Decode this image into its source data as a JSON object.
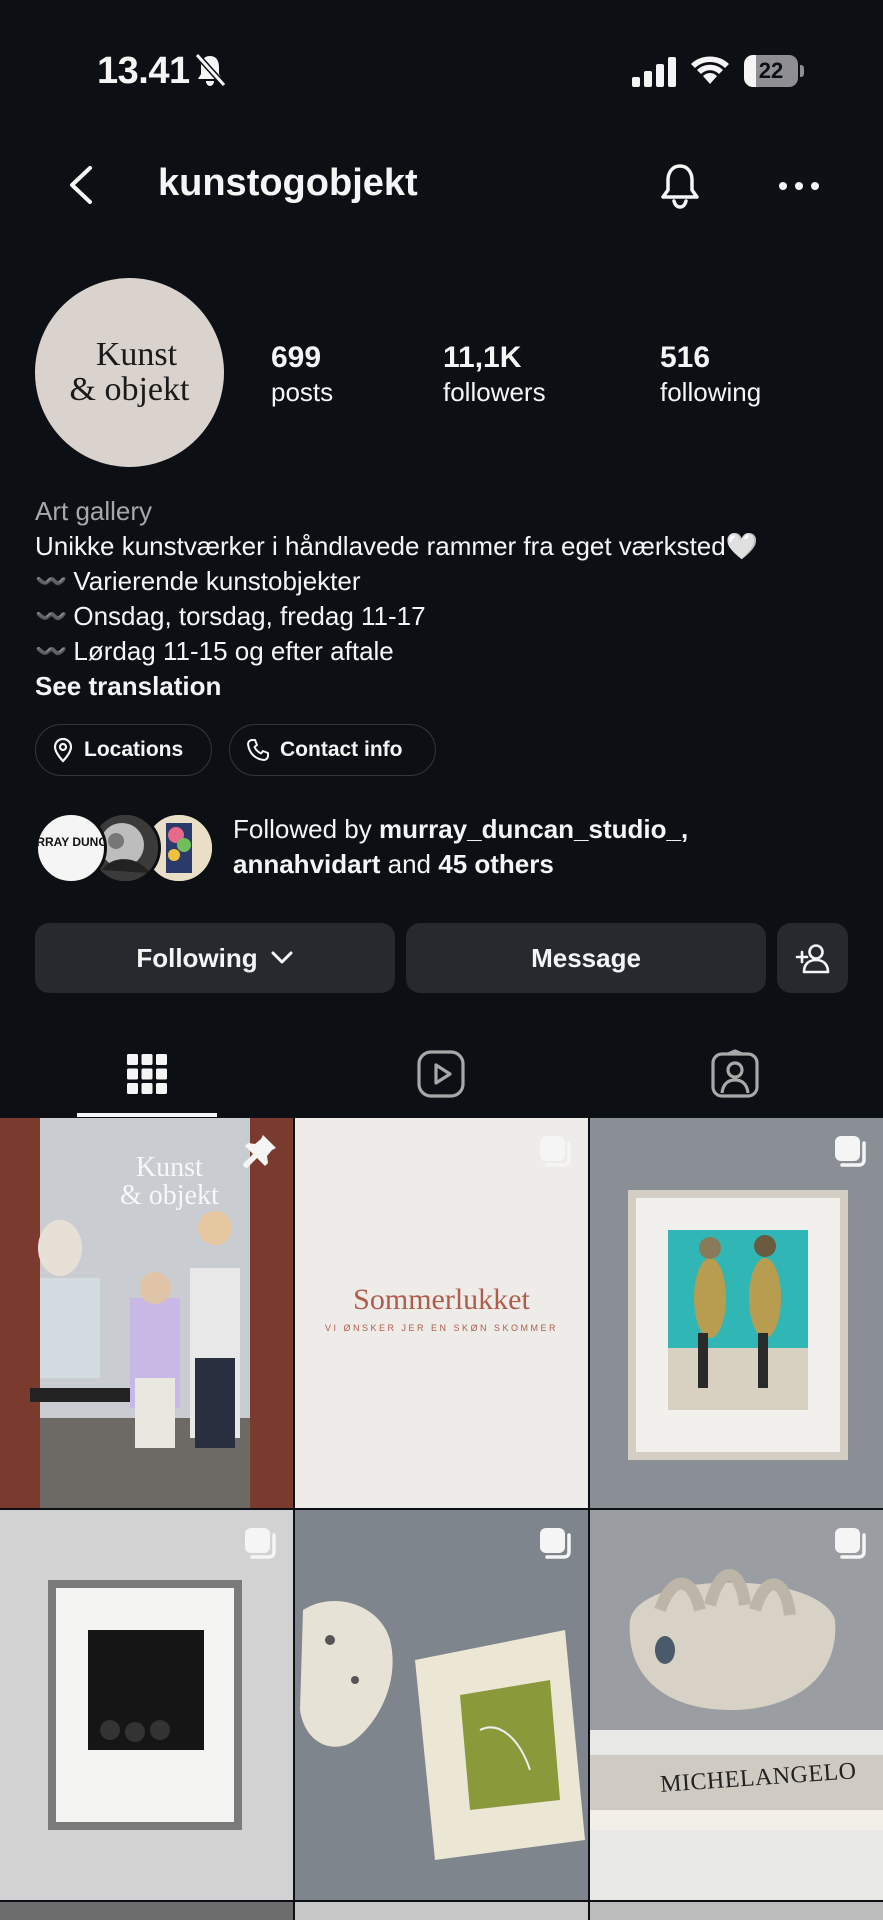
{
  "status_bar": {
    "time": "13.41",
    "battery_level": "22",
    "icons": [
      "bell-slash-icon",
      "cellular-signal-icon",
      "wifi-icon",
      "battery-icon"
    ]
  },
  "header": {
    "username": "kunstogobjekt",
    "icons": [
      "chevron-left-icon",
      "bell-icon",
      "ellipsis-icon"
    ]
  },
  "profile": {
    "avatar_line1": "Kunst",
    "avatar_line2": "& objekt",
    "stats": {
      "posts_value": "699",
      "posts_label": "posts",
      "followers_value": "11,1K",
      "followers_label": "followers",
      "following_value": "516",
      "following_label": "following"
    },
    "bio": {
      "category": "Art gallery",
      "line1": "Unikke kunstværker i håndlavede rammer fra eget værksted🤍",
      "wave": "〰️",
      "line2": "Varierende kunstobjekter",
      "line3": "Onsdag, torsdag, fredag 11-17",
      "line4": "Lørdag 11-15 og efter aftale",
      "see_translation": "See translation"
    },
    "chips": {
      "locations": "Locations",
      "contact": "Contact info"
    },
    "followed_by": {
      "prefix": "Followed by",
      "user1": "murray_duncan_studio_,",
      "user2": "annahvidart",
      "and": "and",
      "others": "45 others",
      "mutual1_text": "MURRAY DUNCAN"
    }
  },
  "actions": {
    "following": "Following",
    "message": "Message"
  },
  "tabs": [
    "grid-icon",
    "reels-icon",
    "tagged-icon"
  ],
  "grid": {
    "post1_sign_line1": "Kunst",
    "post1_sign_line2": "& objekt",
    "post2_title": "Sommerlukket",
    "post2_subtitle": "VI ØNSKER JER EN SKØN SKOMMER",
    "post6_book": "MICHELANGELO"
  },
  "colors": {
    "background": "#0c1014",
    "button": "#262a2f",
    "text": "#f5f5f5",
    "muted": "#a8a8a8",
    "accent_post2": "#b05c4b"
  }
}
